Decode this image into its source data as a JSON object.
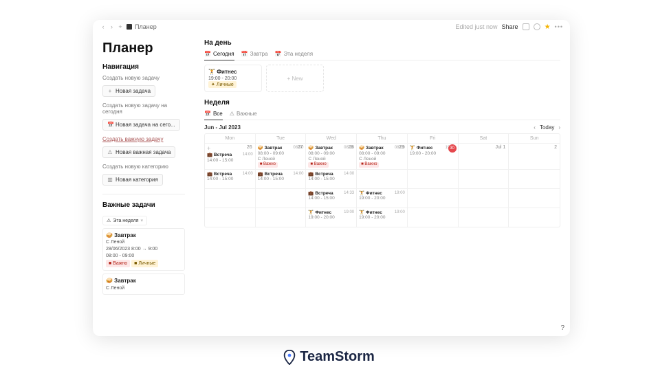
{
  "topbar": {
    "breadcrumb": "Планер",
    "edited": "Edited just now",
    "share": "Share"
  },
  "page": {
    "title": "Планер"
  },
  "sidebar": {
    "nav_heading": "Навигация",
    "groups": [
      {
        "label": "Создать новую задачу",
        "button": "Новая задача",
        "icon": "+"
      },
      {
        "label": "Создать новую задачу на сегодня",
        "button": "Новая задача на сего...",
        "icon": "📅"
      },
      {
        "label": "Создать важную задачу",
        "button": "Новая важная задача",
        "icon": "⚠",
        "underline": true
      },
      {
        "label": "Создать новую категорию",
        "button": "Новая категория",
        "icon": "▥"
      }
    ],
    "important": {
      "heading": "Важные задачи",
      "filter": "Эта неделя",
      "items": [
        {
          "emoji": "🥪",
          "title": "Завтрак",
          "sub": "С Леной",
          "date": "28/06/2023 8:00 → 9:00",
          "time": "08:00 - 09:00",
          "tags": [
            {
              "t": "Важно",
              "c": "red"
            },
            {
              "t": "Личные",
              "c": "yel"
            }
          ]
        },
        {
          "emoji": "🥪",
          "title": "Завтрак",
          "sub": "С Леной"
        }
      ]
    }
  },
  "main": {
    "day": {
      "heading": "На день",
      "tabs": [
        {
          "icon": "📅",
          "label": "Сегодня",
          "active": true
        },
        {
          "icon": "📅",
          "label": "Завтра"
        },
        {
          "icon": "📅",
          "label": "Эта неделя"
        }
      ],
      "card": {
        "emoji": "🏋️",
        "title": "Фитнес",
        "time": "19:00 - 20:00",
        "tag": {
          "t": "Личные",
          "c": "yel"
        }
      },
      "new": "+ New"
    },
    "week": {
      "heading": "Неделя",
      "tabs": [
        {
          "icon": "📅",
          "label": "Все",
          "active": true
        },
        {
          "icon": "⚠",
          "label": "Важные"
        }
      ],
      "range": "Jun - Jul 2023",
      "today": "Today",
      "dayheaders": [
        "Mon",
        "Tue",
        "Wed",
        "Thu",
        "Fri",
        "Sat",
        "Sun"
      ],
      "days": [
        {
          "num": "26",
          "events": [
            {
              "t": "Встреча",
              "tm": "14:00",
              "time": "14:00 - 15:00",
              "e": "💼"
            }
          ]
        },
        {
          "num": "27",
          "events": [
            {
              "t": "Завтрак",
              "tm": "08:00",
              "time": "08:00 - 09:00",
              "sub": "С Леной",
              "tag": "Важно",
              "e": "🥪"
            }
          ]
        },
        {
          "num": "28",
          "events": [
            {
              "t": "Завтрак",
              "tm": "08:00",
              "time": "08:00 - 09:00",
              "sub": "С Леной",
              "tag": "Важно",
              "e": "🥪"
            }
          ]
        },
        {
          "num": "29",
          "events": [
            {
              "t": "Завтрак",
              "tm": "08:00",
              "time": "08:00 - 09:00",
              "sub": "С Леной",
              "tag": "Важно",
              "e": "🥪"
            }
          ]
        },
        {
          "num": "30",
          "badge": true,
          "events": [
            {
              "t": "Фитнес",
              "tm": "19:00",
              "time": "19:00 - 20:00",
              "e": "🏋️"
            }
          ]
        },
        {
          "num": "Jul 1"
        },
        {
          "num": "2"
        }
      ],
      "row2": [
        {
          "events": [
            {
              "t": "Встреча",
              "tm": "14:00",
              "time": "14:00 - 15:00",
              "e": "💼"
            }
          ]
        },
        {
          "events": [
            {
              "t": "Встреча",
              "tm": "14:00",
              "time": "14:00 - 15:00",
              "e": "💼"
            }
          ]
        },
        {
          "events": [
            {
              "t": "Встреча",
              "tm": "14:00",
              "time": "14:00 - 15:00",
              "e": "💼"
            }
          ]
        },
        {},
        {},
        {},
        {}
      ],
      "row3": [
        {},
        {},
        {
          "events": [
            {
              "t": "Встреча",
              "tm": "14:33",
              "time": "14:00 - 15:00",
              "e": "💼"
            }
          ]
        },
        {
          "events": [
            {
              "t": "Фитнес",
              "tm": "19:00",
              "time": "19:00 - 20:00",
              "e": "🏋️"
            }
          ]
        },
        {},
        {},
        {}
      ],
      "row4": [
        {},
        {},
        {
          "events": [
            {
              "t": "Фитнес",
              "tm": "19:00",
              "time": "19:00 - 20:00",
              "e": "🏋️"
            }
          ]
        },
        {
          "events": [
            {
              "t": "Фитнес",
              "tm": "19:00",
              "time": "19:00 - 20:00",
              "e": "🏋️"
            }
          ]
        },
        {},
        {},
        {}
      ]
    }
  },
  "brand": "TeamStorm"
}
